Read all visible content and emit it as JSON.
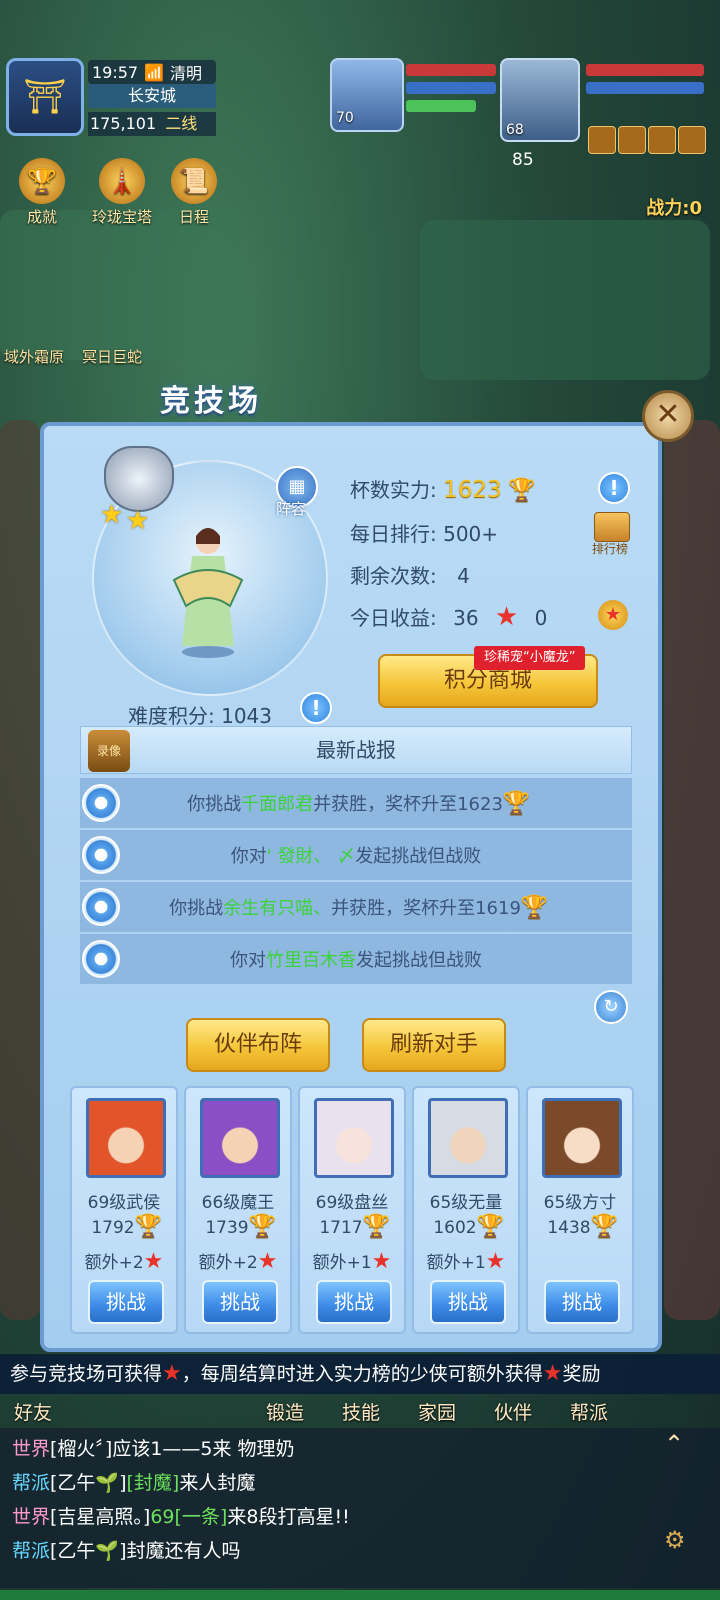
{
  "hud": {
    "time": "19:57",
    "weather": "清明",
    "city": "长安城",
    "coords": "175,101",
    "line": "二线",
    "pet_level": "70",
    "hero_level": "68",
    "hero_sub": "85",
    "power": "战力:0"
  },
  "top_icons": [
    {
      "label": "成就"
    },
    {
      "label": "玲珑宝塔"
    },
    {
      "label": "日程"
    }
  ],
  "side_labels": {
    "left1": "域外霜原",
    "left2": "冥日巨蛇"
  },
  "arena": {
    "title": "竞技场",
    "lineup_label": "阵容",
    "stats": {
      "trophy_label": "杯数实力:",
      "trophy_value": "1623",
      "daily_rank_label": "每日排行:",
      "daily_rank_value": "500+",
      "remaining_label": "剩余次数:",
      "remaining_value": "4",
      "earnings_label": "今日收益:",
      "earnings_stars": "36",
      "earnings_medals": "0"
    },
    "rank_board_label": "排行榜",
    "shop_button": "积分商城",
    "shop_tag": "珍稀宠“小魔龙”",
    "difficulty_label": "难度积分:",
    "difficulty_value": "1043",
    "report_title": "最新战报",
    "replay_label": "录像",
    "reports": [
      {
        "pre": "你挑战",
        "opponent": "千面郎君",
        "post": "并获胜，奖杯升至1623",
        "trophy": true
      },
      {
        "pre": "你对",
        "opponent": "' 發財、 〆",
        "post": "发起挑战但战败",
        "trophy": false
      },
      {
        "pre": "你挑战",
        "opponent": "余生有只喵、",
        "post": "并获胜，奖杯升至1619",
        "trophy": true
      },
      {
        "pre": "你对",
        "opponent": "竹里百木香",
        "post": "发起挑战但战败",
        "trophy": false
      }
    ],
    "buttons": {
      "partner_lineup": "伙伴布阵",
      "refresh_opponents": "刷新对手"
    },
    "opponents": [
      {
        "name": "69级武侯",
        "trophies": "1792",
        "extra": "额外+2",
        "challenge": "挑战",
        "color": "#e2552a"
      },
      {
        "name": "66级魔王",
        "trophies": "1739",
        "extra": "额外+2",
        "challenge": "挑战",
        "color": "#8a4fc4"
      },
      {
        "name": "69级盘丝",
        "trophies": "1717",
        "extra": "额外+1",
        "challenge": "挑战",
        "color": "#e9e2ee"
      },
      {
        "name": "65级无量",
        "trophies": "1602",
        "extra": "额外+1",
        "challenge": "挑战",
        "color": "#d7dbe3"
      },
      {
        "name": "65级方寸",
        "trophies": "1438",
        "extra": "",
        "challenge": "挑战",
        "color": "#7a4a2a"
      }
    ]
  },
  "notice": {
    "part1": "参与竞技场可获得",
    "part2": "，每周结算时进入实力榜的少侠可额外获得",
    "part3": "奖励"
  },
  "bottom_menu": [
    "好友",
    "锻造",
    "技能",
    "家园",
    "伙伴",
    "帮派"
  ],
  "chat": [
    {
      "tag": "世界",
      "tag_type": "world",
      "name": "[榴火〞]",
      "green": "",
      "text": "应该1——5来 物理奶"
    },
    {
      "tag": "帮派",
      "tag_type": "guild",
      "name": "[乙午🌱]",
      "green": "[封魔]",
      "text": "来人封魔"
    },
    {
      "tag": "世界",
      "tag_type": "world",
      "name": "[吉星高照。]",
      "green": "69[一条]",
      "text": "来8段打高星!!"
    },
    {
      "tag": "帮派",
      "tag_type": "guild",
      "name": "[乙午🌱]",
      "green": "",
      "text": "封魔还有人吗"
    }
  ],
  "colors": {
    "gold": "#f5c125",
    "panel": "#b9dbf5",
    "accent_blue": "#3b8ae6",
    "opponent_green": "#3bd23b"
  }
}
